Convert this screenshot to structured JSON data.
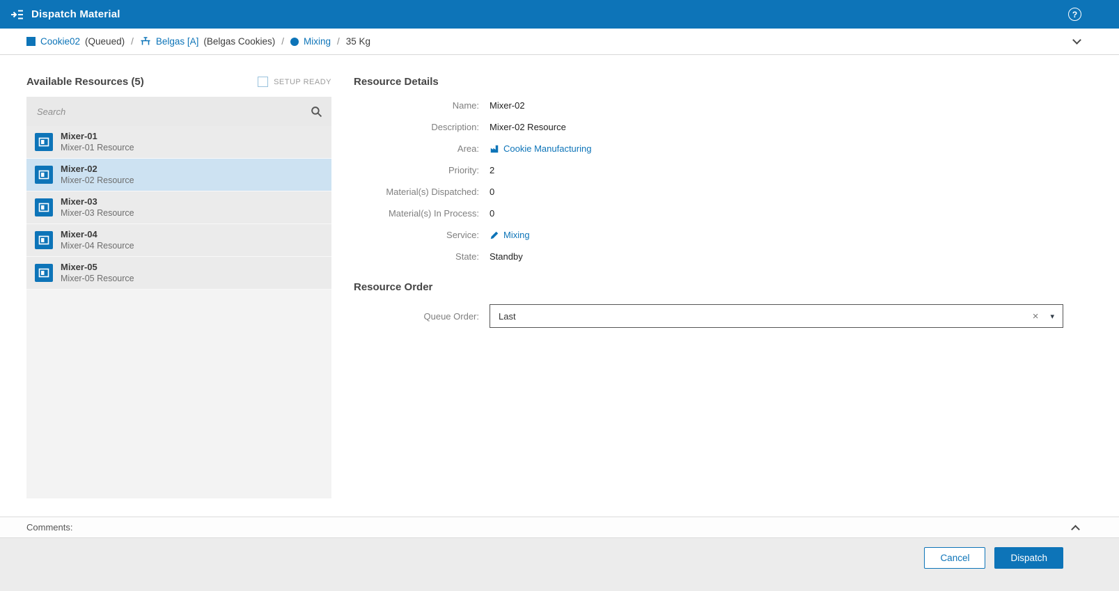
{
  "colors": {
    "accent": "#0d74b8",
    "header_bg": "#0d74b8",
    "selected_row_bg": "#cde2f2",
    "panel_bg": "#f3f3f3",
    "row_bg": "#ebebeb",
    "footer_bg": "#ececec"
  },
  "header": {
    "title": "Dispatch Material",
    "help_glyph": "?"
  },
  "breadcrumb": {
    "separator": "/",
    "material_name": "Cookie02",
    "material_state": "(Queued)",
    "equipment_name": "Belgas [A]",
    "equipment_description": "(Belgas Cookies)",
    "step_name": "Mixing",
    "quantity": "35 Kg"
  },
  "resources": {
    "title": "Available Resources (5)",
    "setup_ready_label": "SETUP READY",
    "search_placeholder": "Search",
    "items": [
      {
        "name": "Mixer-01",
        "description": "Mixer-01 Resource",
        "selected": false
      },
      {
        "name": "Mixer-02",
        "description": "Mixer-02 Resource",
        "selected": true
      },
      {
        "name": "Mixer-03",
        "description": "Mixer-03 Resource",
        "selected": false
      },
      {
        "name": "Mixer-04",
        "description": "Mixer-04 Resource",
        "selected": false
      },
      {
        "name": "Mixer-05",
        "description": "Mixer-05 Resource",
        "selected": false
      }
    ]
  },
  "details": {
    "title": "Resource Details",
    "fields": [
      {
        "label": "Name:",
        "value": "Mixer-02"
      },
      {
        "label": "Description:",
        "value": "Mixer-02 Resource"
      },
      {
        "label": "Area:",
        "value": "Cookie Manufacturing"
      },
      {
        "label": "Priority:",
        "value": "2"
      },
      {
        "label": "Material(s) Dispatched:",
        "value": "0"
      },
      {
        "label": "Material(s) In Process:",
        "value": "0"
      },
      {
        "label": "Service:",
        "value": "Mixing"
      },
      {
        "label": "State:",
        "value": "Standby"
      }
    ]
  },
  "order": {
    "title": "Resource Order",
    "queue_label": "Queue Order:",
    "queue_value": "Last",
    "clear_glyph": "×",
    "caret_glyph": "▾"
  },
  "comments": {
    "label": "Comments:"
  },
  "footer": {
    "cancel_label": "Cancel",
    "dispatch_label": "Dispatch"
  }
}
